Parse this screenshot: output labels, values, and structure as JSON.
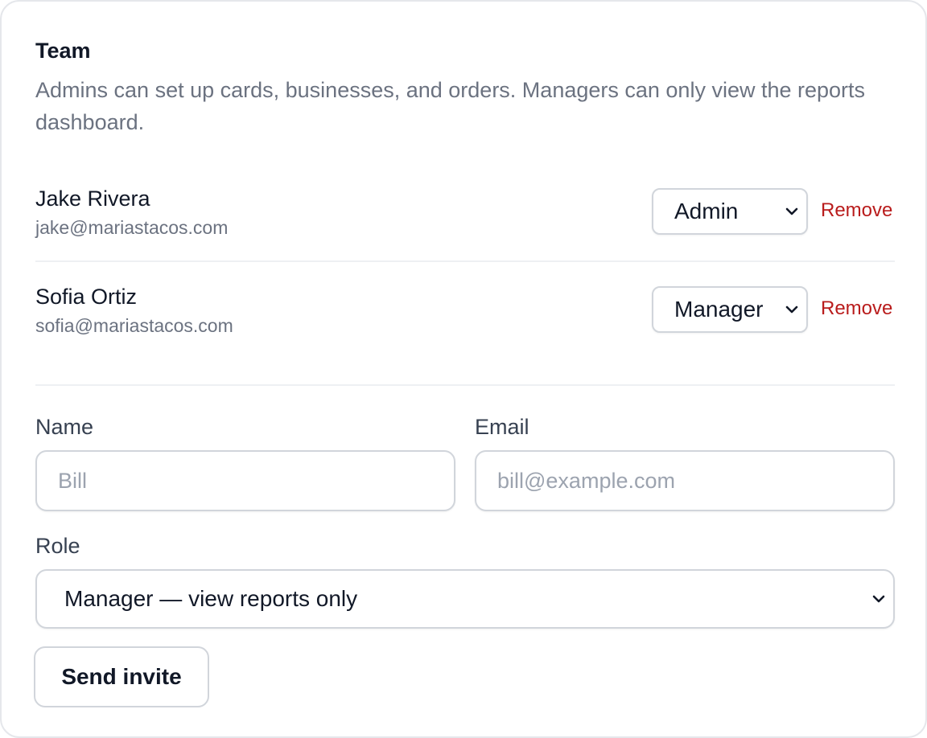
{
  "team": {
    "title": "Team",
    "description": "Admins can set up cards, businesses, and orders. Managers can only view the reports dashboard."
  },
  "members": [
    {
      "name": "Jake Rivera",
      "email": "jake@mariastacos.com",
      "role": "Admin",
      "remove_label": "Remove"
    },
    {
      "name": "Sofia Ortiz",
      "email": "sofia@mariastacos.com",
      "role": "Manager",
      "remove_label": "Remove"
    }
  ],
  "invite_form": {
    "name_label": "Name",
    "name_placeholder": "Bill",
    "email_label": "Email",
    "email_placeholder": "bill@example.com",
    "role_label": "Role",
    "role_selected": "Manager — view reports only",
    "submit_label": "Send invite"
  },
  "colors": {
    "danger": "#b91c1c",
    "text_primary": "#111827",
    "text_muted": "#6b7280",
    "border": "#d1d5db"
  },
  "icons": {
    "select_arrow": "chevron-down-icon"
  }
}
